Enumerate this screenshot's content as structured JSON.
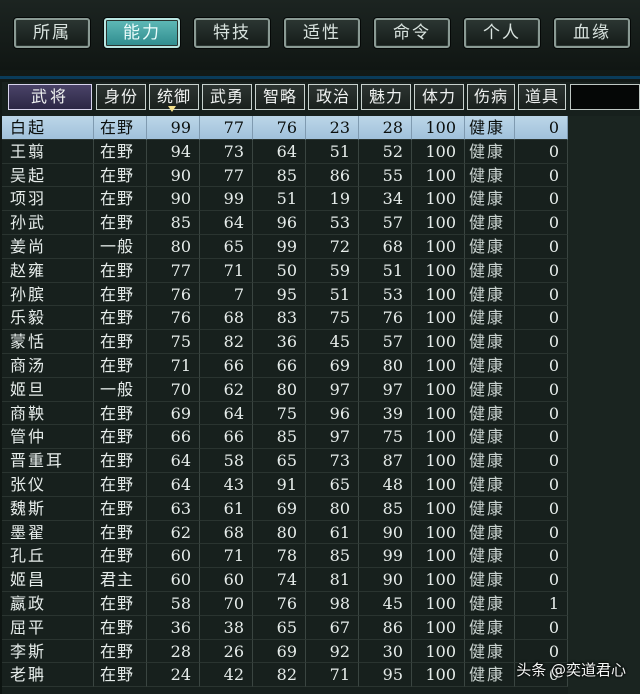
{
  "tabs": [
    {
      "label": "所属",
      "active": false
    },
    {
      "label": "能力",
      "active": true
    },
    {
      "label": "特技",
      "active": false
    },
    {
      "label": "适性",
      "active": false
    },
    {
      "label": "命令",
      "active": false
    },
    {
      "label": "个人",
      "active": false
    },
    {
      "label": "血缘",
      "active": false
    }
  ],
  "columns": [
    "武将",
    "身份",
    "统御",
    "武勇",
    "智略",
    "政治",
    "魅力",
    "体力",
    "伤病",
    "道具"
  ],
  "sorted_column": "统御",
  "rows": [
    {
      "name": "白起",
      "status": "在野",
      "lead": "99",
      "war": "77",
      "int": "76",
      "pol": "23",
      "cha": "28",
      "hp": "100",
      "injury": "健康",
      "item": "0",
      "selected": true
    },
    {
      "name": "王翦",
      "status": "在野",
      "lead": "94",
      "war": "73",
      "int": "64",
      "pol": "51",
      "cha": "52",
      "hp": "100",
      "injury": "健康",
      "item": "0"
    },
    {
      "name": "吴起",
      "status": "在野",
      "lead": "90",
      "war": "77",
      "int": "85",
      "pol": "86",
      "cha": "55",
      "hp": "100",
      "injury": "健康",
      "item": "0"
    },
    {
      "name": "项羽",
      "status": "在野",
      "lead": "90",
      "war": "99",
      "int": "51",
      "pol": "19",
      "cha": "34",
      "hp": "100",
      "injury": "健康",
      "item": "0"
    },
    {
      "name": "孙武",
      "status": "在野",
      "lead": "85",
      "war": "64",
      "int": "96",
      "pol": "53",
      "cha": "57",
      "hp": "100",
      "injury": "健康",
      "item": "0"
    },
    {
      "name": "姜尚",
      "status": "一般",
      "lead": "80",
      "war": "65",
      "int": "99",
      "pol": "72",
      "cha": "68",
      "hp": "100",
      "injury": "健康",
      "item": "0"
    },
    {
      "name": "赵雍",
      "status": "在野",
      "lead": "77",
      "war": "71",
      "int": "50",
      "pol": "59",
      "cha": "51",
      "hp": "100",
      "injury": "健康",
      "item": "0"
    },
    {
      "name": "孙膑",
      "status": "在野",
      "lead": "76",
      "war": "7",
      "int": "95",
      "pol": "51",
      "cha": "53",
      "hp": "100",
      "injury": "健康",
      "item": "0"
    },
    {
      "name": "乐毅",
      "status": "在野",
      "lead": "76",
      "war": "68",
      "int": "83",
      "pol": "75",
      "cha": "76",
      "hp": "100",
      "injury": "健康",
      "item": "0"
    },
    {
      "name": "蒙恬",
      "status": "在野",
      "lead": "75",
      "war": "82",
      "int": "36",
      "pol": "45",
      "cha": "57",
      "hp": "100",
      "injury": "健康",
      "item": "0"
    },
    {
      "name": "商汤",
      "status": "在野",
      "lead": "71",
      "war": "66",
      "int": "66",
      "pol": "69",
      "cha": "80",
      "hp": "100",
      "injury": "健康",
      "item": "0"
    },
    {
      "name": "姬旦",
      "status": "一般",
      "lead": "70",
      "war": "62",
      "int": "80",
      "pol": "97",
      "cha": "97",
      "hp": "100",
      "injury": "健康",
      "item": "0"
    },
    {
      "name": "商鞅",
      "status": "在野",
      "lead": "69",
      "war": "64",
      "int": "75",
      "pol": "96",
      "cha": "39",
      "hp": "100",
      "injury": "健康",
      "item": "0"
    },
    {
      "name": "管仲",
      "status": "在野",
      "lead": "66",
      "war": "66",
      "int": "85",
      "pol": "97",
      "cha": "75",
      "hp": "100",
      "injury": "健康",
      "item": "0"
    },
    {
      "name": "晋重耳",
      "status": "在野",
      "lead": "64",
      "war": "58",
      "int": "65",
      "pol": "73",
      "cha": "87",
      "hp": "100",
      "injury": "健康",
      "item": "0"
    },
    {
      "name": "张仪",
      "status": "在野",
      "lead": "64",
      "war": "43",
      "int": "91",
      "pol": "65",
      "cha": "48",
      "hp": "100",
      "injury": "健康",
      "item": "0"
    },
    {
      "name": "魏斯",
      "status": "在野",
      "lead": "63",
      "war": "61",
      "int": "69",
      "pol": "80",
      "cha": "85",
      "hp": "100",
      "injury": "健康",
      "item": "0"
    },
    {
      "name": "墨翟",
      "status": "在野",
      "lead": "62",
      "war": "68",
      "int": "80",
      "pol": "61",
      "cha": "90",
      "hp": "100",
      "injury": "健康",
      "item": "0"
    },
    {
      "name": "孔丘",
      "status": "在野",
      "lead": "60",
      "war": "71",
      "int": "78",
      "pol": "85",
      "cha": "99",
      "hp": "100",
      "injury": "健康",
      "item": "0"
    },
    {
      "name": "姬昌",
      "status": "君主",
      "lead": "60",
      "war": "60",
      "int": "74",
      "pol": "81",
      "cha": "90",
      "hp": "100",
      "injury": "健康",
      "item": "0"
    },
    {
      "name": "嬴政",
      "status": "在野",
      "lead": "58",
      "war": "70",
      "int": "76",
      "pol": "98",
      "cha": "45",
      "hp": "100",
      "injury": "健康",
      "item": "1"
    },
    {
      "name": "屈平",
      "status": "在野",
      "lead": "36",
      "war": "38",
      "int": "65",
      "pol": "67",
      "cha": "86",
      "hp": "100",
      "injury": "健康",
      "item": "0"
    },
    {
      "name": "李斯",
      "status": "在野",
      "lead": "28",
      "war": "26",
      "int": "69",
      "pol": "92",
      "cha": "30",
      "hp": "100",
      "injury": "健康",
      "item": "0"
    },
    {
      "name": "老聃",
      "status": "在野",
      "lead": "24",
      "war": "42",
      "int": "82",
      "pol": "71",
      "cha": "95",
      "hp": "100",
      "injury": "健康",
      "item": "0"
    }
  ],
  "watermark": "头条 @奕道君心",
  "colors": {
    "active_tab": "#3fa3a3",
    "selected_row": "#b2cde2",
    "header_first": "#3b3558"
  }
}
